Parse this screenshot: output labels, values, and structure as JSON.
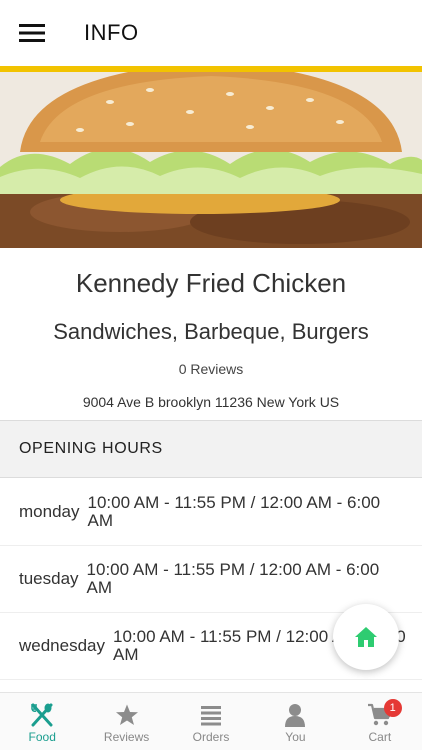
{
  "header": {
    "title": "INFO"
  },
  "restaurant": {
    "name": "Kennedy Fried Chicken",
    "cuisines": "Sandwiches, Barbeque, Burgers",
    "reviews": "0 Reviews",
    "address": "9004 Ave B brooklyn 11236 New York US"
  },
  "opening_hours": {
    "title": "OPENING HOURS",
    "days": [
      {
        "day": "monday",
        "hours": "10:00 AM - 11:55 PM   / 12:00 AM - 6:00 AM"
      },
      {
        "day": "tuesday",
        "hours": "10:00 AM - 11:55 PM   / 12:00 AM - 6:00 AM"
      },
      {
        "day": "wednesday",
        "hours": "10:00 AM - 11:55 PM   / 12:00 AM - 6:00 AM"
      }
    ]
  },
  "tabs": [
    {
      "label": "Food",
      "icon": "food-icon"
    },
    {
      "label": "Reviews",
      "icon": "star-icon"
    },
    {
      "label": "Orders",
      "icon": "list-icon"
    },
    {
      "label": "You",
      "icon": "user-icon"
    },
    {
      "label": "Cart",
      "icon": "cart-icon",
      "badge": "1"
    }
  ],
  "colors": {
    "accent": "#f2c300",
    "active_tab": "#1a9e8f",
    "fab_icon": "#2ecc71",
    "badge": "#e53935"
  }
}
